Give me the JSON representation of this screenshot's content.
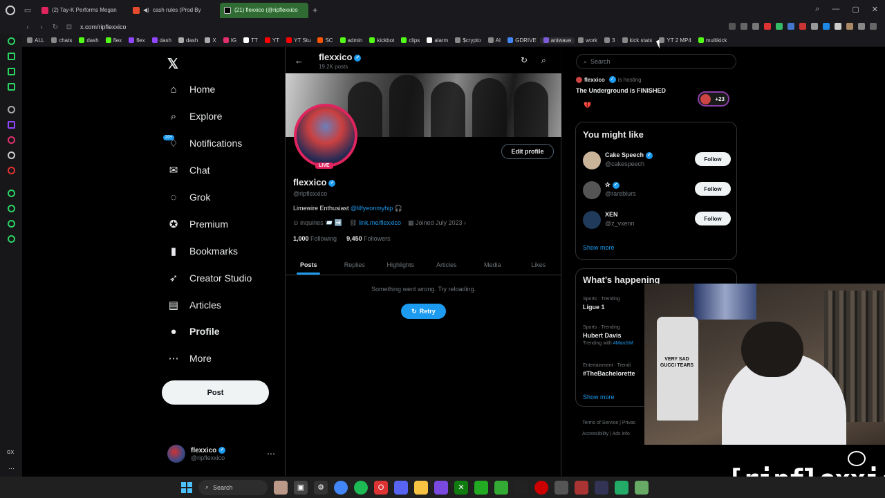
{
  "browser": {
    "tabs": [
      {
        "label": "(2) Tay-K Performs Megan",
        "color": "#e0245e",
        "active": false
      },
      {
        "label": "cash rules (Prod By",
        "color": "#e54b2c",
        "active": false
      },
      {
        "label": "(21) flexxico (@ripflexxico",
        "color": "#000000",
        "active": true
      }
    ],
    "url": "x.com/ripflexxico",
    "bookmarks": [
      {
        "label": "ALL",
        "color": "#888"
      },
      {
        "label": "chats",
        "color": "#888"
      },
      {
        "label": "dash",
        "color": "#53fc18"
      },
      {
        "label": "flex",
        "color": "#53fc18"
      },
      {
        "label": "flex",
        "color": "#9146ff"
      },
      {
        "label": "dash",
        "color": "#9146ff"
      },
      {
        "label": "dash",
        "color": "#aaa"
      },
      {
        "label": "X",
        "color": "#aaa"
      },
      {
        "label": "IG",
        "color": "#e1306c"
      },
      {
        "label": "TT",
        "color": "#fff"
      },
      {
        "label": "YT",
        "color": "#f00"
      },
      {
        "label": "YT Stu",
        "color": "#f00"
      },
      {
        "label": "SC",
        "color": "#ff5500"
      },
      {
        "label": "admin",
        "color": "#53fc18"
      },
      {
        "label": "kickbot",
        "color": "#53fc18"
      },
      {
        "label": "clips",
        "color": "#53fc18"
      },
      {
        "label": "alarm",
        "color": "#fff"
      },
      {
        "label": "$crypto",
        "color": "#888"
      },
      {
        "label": "AI",
        "color": "#888"
      },
      {
        "label": "GDRIVE",
        "color": "#4285f4"
      },
      {
        "label": "aniwave",
        "color": "#7b5cd6"
      },
      {
        "label": "work",
        "color": "#888"
      },
      {
        "label": "3",
        "color": "#888"
      },
      {
        "label": "kick stats",
        "color": "#888"
      },
      {
        "label": "YT 2 MP4",
        "color": "#888"
      },
      {
        "label": "multikick",
        "color": "#53fc18"
      }
    ]
  },
  "sidebar": {
    "items": [
      {
        "label": "Home",
        "icon": "home-icon",
        "glyph": "⌂"
      },
      {
        "label": "Explore",
        "icon": "search-icon",
        "glyph": "⌕"
      },
      {
        "label": "Notifications",
        "icon": "bell-icon",
        "glyph": "♢"
      },
      {
        "label": "Chat",
        "icon": "mail-icon",
        "glyph": "✉"
      },
      {
        "label": "Grok",
        "icon": "grok-icon",
        "glyph": "◌"
      },
      {
        "label": "Premium",
        "icon": "premium-icon",
        "glyph": "✪"
      },
      {
        "label": "Bookmarks",
        "icon": "bookmark-icon",
        "glyph": "▮"
      },
      {
        "label": "Creator Studio",
        "icon": "rocket-icon",
        "glyph": "➶"
      },
      {
        "label": "Articles",
        "icon": "article-icon",
        "glyph": "▤"
      },
      {
        "label": "Profile",
        "icon": "profile-icon",
        "glyph": "●"
      },
      {
        "label": "More",
        "icon": "more-icon",
        "glyph": "⋯"
      }
    ],
    "notif_badge": "20+",
    "post_label": "Post",
    "account_name": "flexxico",
    "account_handle": "@ripflexxico"
  },
  "profile": {
    "header_name": "flexxico",
    "header_posts": "19.2K posts",
    "name": "flexxico",
    "handle": "@ripflexxico",
    "live_label": "LIVE",
    "edit_label": "Edit profile",
    "bio_text": "Limewire Enthusiast ",
    "bio_link": "@lilfyeonmyhip",
    "bio_emoji": " 🎧",
    "location": "inquiries 📨 ➡️",
    "website": "link.me/flexxico",
    "joined": "Joined July 2023",
    "following_count": "1,000",
    "following_label": "Following",
    "followers_count": "9,450",
    "followers_label": "Followers",
    "tabs": [
      "Posts",
      "Replies",
      "Highlights",
      "Articles",
      "Media",
      "Likes"
    ],
    "error_text": "Something went wrong. Try reloading.",
    "retry_label": "Retry"
  },
  "right": {
    "search_placeholder": "Search",
    "space_host": "flexxico",
    "space_hosting": "is hosting",
    "space_title": "The Underground is FINISHED",
    "space_count": "+23",
    "wtf_title": "You might like",
    "suggestions": [
      {
        "name": "Cake Speech",
        "handle": "@cakespeech",
        "avatar_color": "#c9b49a"
      },
      {
        "name": "✰",
        "handle": "@rareblurs",
        "avatar_color": "#555"
      },
      {
        "name": "XEN",
        "handle": "@z_vxenn",
        "avatar_color": "#1f3a5a"
      }
    ],
    "follow_label": "Follow",
    "show_more": "Show more",
    "trends_title": "What’s happening",
    "trends": [
      {
        "meta": "Sports · Trending",
        "name": "Ligue 1",
        "sub": "",
        "sub_link": ""
      },
      {
        "meta": "Sports · Trending",
        "name": "Hubert Davis",
        "sub": "Trending with ",
        "sub_link": "#MarchM"
      },
      {
        "meta": "Entertainment · Trendi",
        "name": "#TheBachelorette",
        "sub": "",
        "sub_link": ""
      }
    ],
    "footer_1": "Terms of Service  |  Privac",
    "footer_2": "Accessibility  |  Ads info"
  },
  "overlay": {
    "shirt_text": "VERY SAD GUCCI TEARS",
    "watermark": "[ripflexxico]"
  },
  "taskbar": {
    "search_label": "Search",
    "gx_label": "GX"
  }
}
